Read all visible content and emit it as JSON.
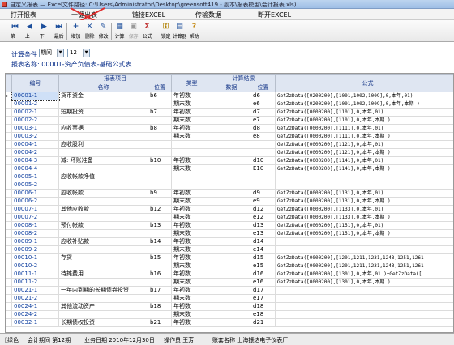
{
  "window": {
    "title": "自定义报表 — Excel文件路径: C:\\Users\\Administrator\\Desktop\\greensoft419 - 副本\\报表模型\\会计报表.xls)"
  },
  "menu": [
    "打开报表",
    "一键出表",
    "链接EXCEL",
    "传输数据",
    "断开EXCEL"
  ],
  "toolbar": [
    {
      "icon": "first-record-icon",
      "glyph": "⏮",
      "label": "第一"
    },
    {
      "icon": "prev-record-icon",
      "glyph": "◀",
      "label": "上一"
    },
    {
      "icon": "next-record-icon",
      "glyph": "▶",
      "label": "下一"
    },
    {
      "icon": "last-record-icon",
      "glyph": "⏭",
      "label": "最后"
    },
    {
      "icon": "add-icon",
      "glyph": "+",
      "label": "增加"
    },
    {
      "icon": "delete-icon",
      "glyph": "✕",
      "label": "删除"
    },
    {
      "icon": "edit-icon",
      "glyph": "✎",
      "label": "修改"
    },
    {
      "icon": "calculate-icon",
      "glyph": "▦",
      "label": "计算"
    },
    {
      "icon": "save-icon",
      "glyph": "▣",
      "label": "保存"
    },
    {
      "icon": "formula-icon",
      "glyph": "Σ",
      "label": "公式"
    },
    {
      "icon": "lock-icon",
      "glyph": "⚿",
      "label": "锁定"
    },
    {
      "icon": "calculator-icon",
      "glyph": "▤",
      "label": "计算器"
    },
    {
      "icon": "help-icon",
      "glyph": "?",
      "label": "帮助"
    }
  ],
  "condition": {
    "label": "计算条件",
    "period_type": "期间",
    "period_value": "12"
  },
  "report": {
    "name": "报表名称: 00001-资产负债表-基础公式表"
  },
  "table": {
    "headers": {
      "code": "编号",
      "item_group": "报表项目",
      "name": "名称",
      "position": "位置",
      "type": "类型",
      "result_group": "计算结果",
      "data": "数据",
      "result_position": "位置",
      "formula": "公式"
    },
    "rows": [
      [
        "00001-1",
        "货币资金",
        "b6",
        "年初数",
        "",
        "d6",
        "GetZzData([0200200],[1001,1002,1009],0,本年,01)"
      ],
      [
        "00001-2",
        "",
        "",
        "期末数",
        "",
        "e6",
        "GetZzData([0200200],[1001,1002,1009],0,本年,本期 )"
      ],
      [
        "00002-1",
        "短期投资",
        "b7",
        "年初数",
        "",
        "d7",
        "GetZzData([0000200],[1101],0,本年,01)"
      ],
      [
        "00002-2",
        "",
        "",
        "期末数",
        "",
        "e7",
        "GetZzData([0000200],[1101],0,本年,本期 )"
      ],
      [
        "00003-1",
        "应收票据",
        "b8",
        "年初数",
        "",
        "d8",
        "GetZzData([0000200],[1111],0,本年,01)"
      ],
      [
        "00003-2",
        "",
        "",
        "期末数",
        "",
        "e8",
        "GetZzData([0000200],[1111],0,本年,本期 )"
      ],
      [
        "00004-1",
        "应收股利",
        "",
        "",
        "",
        "",
        "GetZzData([0000200],[1121],0,本年,01)"
      ],
      [
        "00004-2",
        "",
        "",
        "",
        "",
        "",
        "GetZzData([0000200],[1121],0,本年,本期 )"
      ],
      [
        "00004-3",
        "减: 坏账准备",
        "b10",
        "年初数",
        "",
        "d10",
        "GetZzData([0000200],[1141],0,本年,01)"
      ],
      [
        "00004-4",
        "",
        "",
        "期末数",
        "",
        "E10",
        "GetZzData([0000200],[1141],0,本年,本期 )"
      ],
      [
        "00005-1",
        "应收帐款净值",
        "",
        "",
        "",
        "",
        ""
      ],
      [
        "00005-2",
        "",
        "",
        "",
        "",
        "",
        ""
      ],
      [
        "00006-1",
        "应收帐款",
        "b9",
        "年初数",
        "",
        "d9",
        "GetZzData([0000200],[1131],0,本年,01)"
      ],
      [
        "00006-2",
        "",
        "",
        "期末数",
        "",
        "e9",
        "GetZzData([0000200],[1131],0,本年,本期 )"
      ],
      [
        "00007-1",
        "其他应收款",
        "b12",
        "年初数",
        "",
        "d12",
        "GetZzData([0000200],[1133],0,本年,01)"
      ],
      [
        "00007-2",
        "",
        "",
        "期末数",
        "",
        "e12",
        "GetZzData([0000200],[1133],0,本年,本期 )"
      ],
      [
        "00008-1",
        "预付帐款",
        "b13",
        "年初数",
        "",
        "d13",
        "GetZzData([0000200],[1151],0,本年,01)"
      ],
      [
        "00008-2",
        "",
        "",
        "期末数",
        "",
        "e13",
        "GetZzData([0000200],[1151],0,本年,本期 )"
      ],
      [
        "00009-1",
        "应收补贴款",
        "b14",
        "年初数",
        "",
        "d14",
        ""
      ],
      [
        "00009-2",
        "",
        "",
        "期末数",
        "",
        "e14",
        ""
      ],
      [
        "00010-1",
        "存货",
        "b15",
        "年初数",
        "",
        "d15",
        "GetZzData([0000200],[1201,1211,1231,1243,1251,1261"
      ],
      [
        "00010-2",
        "",
        "",
        "期末数",
        "",
        "e15",
        "GetZzData([0000200],[1201,1211,1231,1243,1251,1261"
      ],
      [
        "00011-1",
        "待摊费用",
        "b16",
        "年初数",
        "",
        "d16",
        "GetZzData([0000200],[1301],0,本年,01 )+GetZzData(["
      ],
      [
        "00011-2",
        "",
        "",
        "期末数",
        "",
        "e16",
        "GetZzData([0000200],[1301],0,本年,本期 )"
      ],
      [
        "00021-1",
        "一年内到期的长期债券投资",
        "b17",
        "年初数",
        "",
        "d17",
        ""
      ],
      [
        "00021-2",
        "",
        "",
        "期末数",
        "",
        "e17",
        ""
      ],
      [
        "00024-1",
        "其他流动资产",
        "b18",
        "年初数",
        "",
        "d18",
        ""
      ],
      [
        "00024-2",
        "",
        "",
        "期末数",
        "",
        "e18",
        ""
      ],
      [
        "00032-1",
        "长期债权投资",
        "b21",
        "年初数",
        "",
        "d21",
        ""
      ]
    ]
  },
  "status": {
    "company": "【绿色",
    "period": "会计期间 第12期",
    "date": "业务日期 2010年12月30日",
    "operator": "操作员 王芳",
    "account": "账套名称 上海振达电子仪表厂"
  },
  "colors": {
    "accent": "#1040a0",
    "header_bg": "#dfe6f2",
    "annotation": "#e03030"
  }
}
